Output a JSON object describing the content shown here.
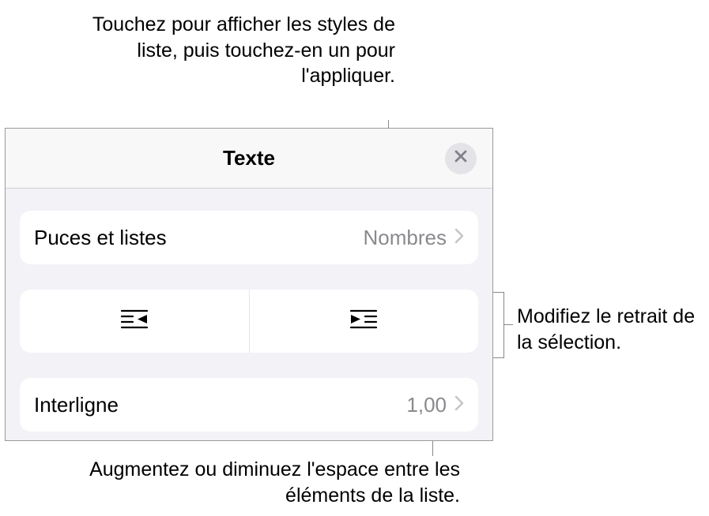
{
  "callouts": {
    "top": "Touchez pour afficher les styles de liste, puis touchez-en un pour l'appliquer.",
    "right": "Modifiez le retrait de la sélection.",
    "bottom": "Augmentez ou diminuez l'espace entre les éléments de la liste."
  },
  "panel": {
    "title": "Texte",
    "bullets": {
      "label": "Puces et listes",
      "value": "Nombres"
    },
    "linespacing": {
      "label": "Interligne",
      "value": "1,00"
    }
  }
}
